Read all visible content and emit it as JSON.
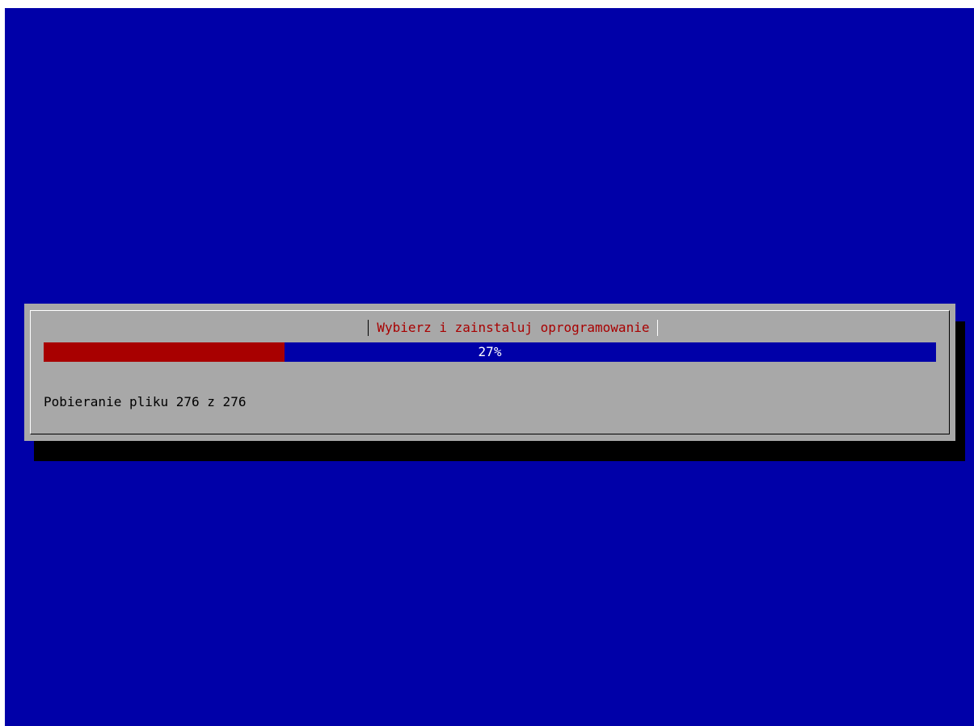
{
  "dialog": {
    "title": "Wybierz i zainstaluj oprogramowanie",
    "progress": {
      "percent": 27,
      "label": "27%"
    },
    "status": "Pobieranie pliku 276 z 276"
  },
  "colors": {
    "background": "#0000a8",
    "dialog_bg": "#a8a8a8",
    "progress_fill": "#a80000",
    "title_text": "#a80000",
    "shadow": "#000000"
  }
}
